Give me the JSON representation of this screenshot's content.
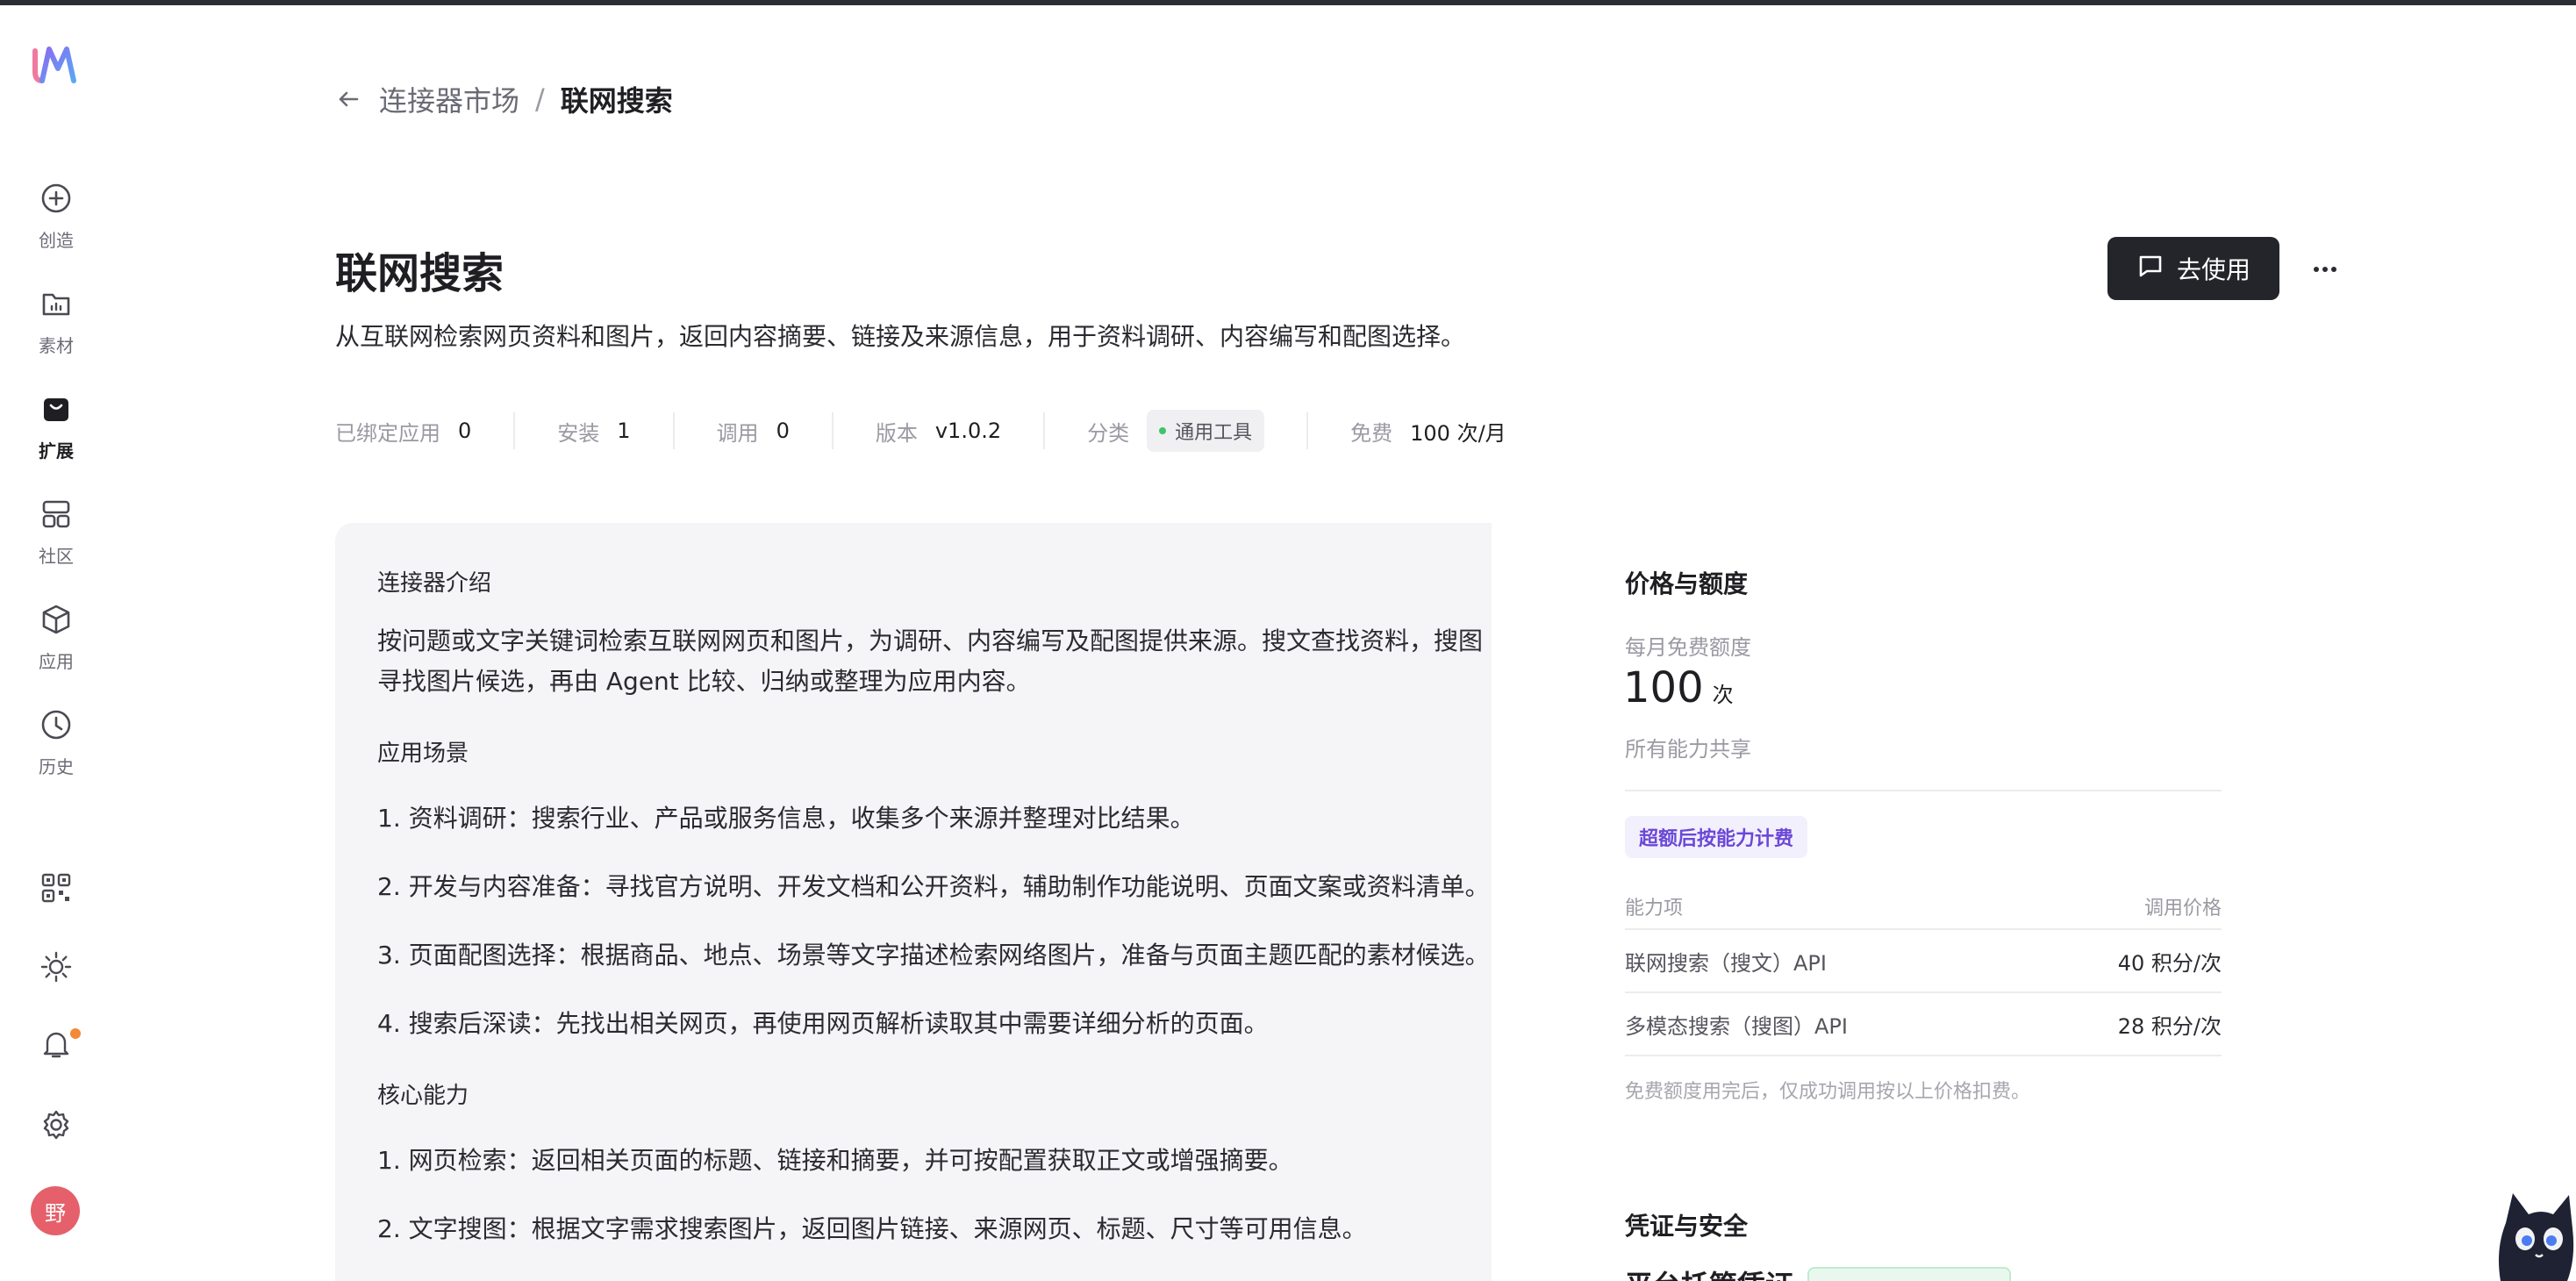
{
  "app": {
    "avatar_text": "野"
  },
  "sidebar": {
    "items": [
      {
        "label": "创造",
        "icon": "plus-circle-icon"
      },
      {
        "label": "素材",
        "icon": "folder-icon"
      },
      {
        "label": "扩展",
        "icon": "bag-icon",
        "active": true
      },
      {
        "label": "社区",
        "icon": "grid-icon"
      },
      {
        "label": "应用",
        "icon": "cube-icon"
      },
      {
        "label": "历史",
        "icon": "clock-icon"
      }
    ],
    "tools": [
      "qr-code-icon",
      "sun-icon",
      "bell-icon",
      "gear-icon"
    ]
  },
  "breadcrumb": {
    "parent": "连接器市场",
    "separator": "/",
    "current": "联网搜索"
  },
  "header": {
    "title": "联网搜索",
    "description": "从互联网检索网页资料和图片，返回内容摘要、链接及来源信息，用于资料调研、内容编写和配图选择。",
    "use_button": "去使用"
  },
  "stats": {
    "bound_label": "已绑定应用",
    "bound_value": "0",
    "install_label": "安装",
    "install_value": "1",
    "calls_label": "调用",
    "calls_value": "0",
    "version_label": "版本",
    "version_value": "v1.0.2",
    "category_label": "分类",
    "category_value": "通用工具",
    "free_label": "免费",
    "free_value": "100 次/月"
  },
  "intro": {
    "heading": "连接器介绍",
    "para_line1": "按问题或文字关键词检索互联网网页和图片，为调研、内容编写及配图提供来源。搜文查找资料，搜图",
    "para_line2": "寻找图片候选，再由 Agent 比较、归纳或整理为应用内容。",
    "scenarios_heading": "应用场景",
    "scenarios": [
      "1. 资料调研：搜索行业、产品或服务信息，收集多个来源并整理对比结果。",
      "2. 开发与内容准备：寻找官方说明、开发文档和公开资料，辅助制作功能说明、页面文案或资料清单。",
      "3. 页面配图选择：根据商品、地点、场景等文字描述检索网络图片，准备与页面主题匹配的素材候选。",
      "4. 搜索后深读：先找出相关网页，再使用网页解析读取其中需要详细分析的页面。"
    ],
    "core_heading": "核心能力",
    "core": [
      "1. 网页检索：返回相关页面的标题、链接和摘要，并可按配置获取正文或增强摘要。",
      "2. 文字搜图：根据文字需求搜索图片，返回图片链接、来源网页、标题、尺寸等可用信息。"
    ]
  },
  "pricing": {
    "title": "价格与额度",
    "free_label": "每月免费额度",
    "free_number": "100",
    "free_unit": "次",
    "shared_note": "所有能力共享",
    "overage_badge": "超额后按能力计费",
    "col_capability": "能力项",
    "col_price": "调用价格",
    "rows": [
      {
        "name": "联网搜索（搜文）API",
        "price": "40 积分/次"
      },
      {
        "name": "多模态搜索（搜图）API",
        "price": "28 积分/次"
      }
    ],
    "footnote": "免费额度用完后，仅成功调用按以上价格扣费。"
  },
  "security": {
    "title": "凭证与安全",
    "subtitle": "平台托管凭证"
  },
  "colors": {
    "accent": "#6b48d6",
    "primary_button": "#23252b",
    "notification": "#f28a3a",
    "avatar": "#e5606a"
  }
}
